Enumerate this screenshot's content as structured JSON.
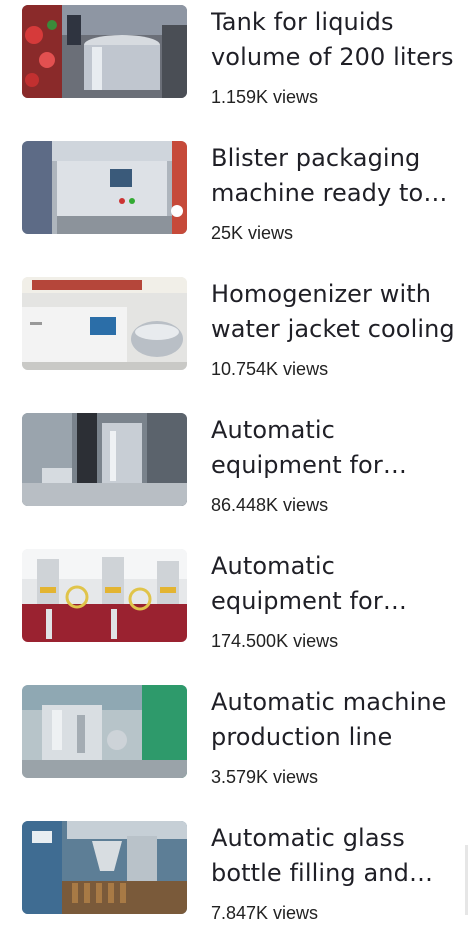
{
  "videos": [
    {
      "title": "Tank for liquids volume of 200 liters",
      "views": "1.159K views",
      "thumb_icon": "stainless-tank-image"
    },
    {
      "title": "Blister packaging machine ready to work",
      "views": "25K views",
      "thumb_icon": "blister-machine-image"
    },
    {
      "title": "Homogenizer with water jacket cooling",
      "views": "10.754K views",
      "thumb_icon": "homogenizer-image"
    },
    {
      "title": "Automatic equipment for filling",
      "views": "86.448K views",
      "thumb_icon": "filling-equipment-image"
    },
    {
      "title": "Automatic equipment for dosing",
      "views": "174.500K views",
      "thumb_icon": "dosing-equipment-image"
    },
    {
      "title": "Automatic machine production line",
      "views": "3.579K views",
      "thumb_icon": "automatic-machine-image"
    },
    {
      "title": "Automatic glass bottle filling and capping",
      "views": "7.847K views",
      "thumb_icon": "bottle-filling-image"
    }
  ]
}
